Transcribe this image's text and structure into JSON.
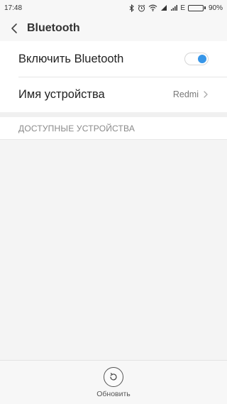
{
  "status_bar": {
    "time": "17:48",
    "network": "E",
    "battery_percent": "90%",
    "battery_level": 0.9,
    "icons": [
      "bluetooth-icon",
      "alarm-icon",
      "wifi-icon",
      "signal-icon",
      "signal-icon",
      "battery-icon"
    ]
  },
  "header": {
    "title": "Bluetooth",
    "back_icon": "chevron-left-icon"
  },
  "settings": {
    "bluetooth_toggle": {
      "label": "Включить Bluetooth",
      "state": "on",
      "accent": "#3796e8"
    },
    "device_name": {
      "label": "Имя устройства",
      "value": "Redmi",
      "icon": "chevron-right-icon"
    }
  },
  "available_devices": {
    "title": "ДОСТУПНЫЕ УСТРОЙСТВА"
  },
  "bottom_bar": {
    "refresh_label": "Обновить",
    "refresh_icon": "refresh-icon"
  }
}
